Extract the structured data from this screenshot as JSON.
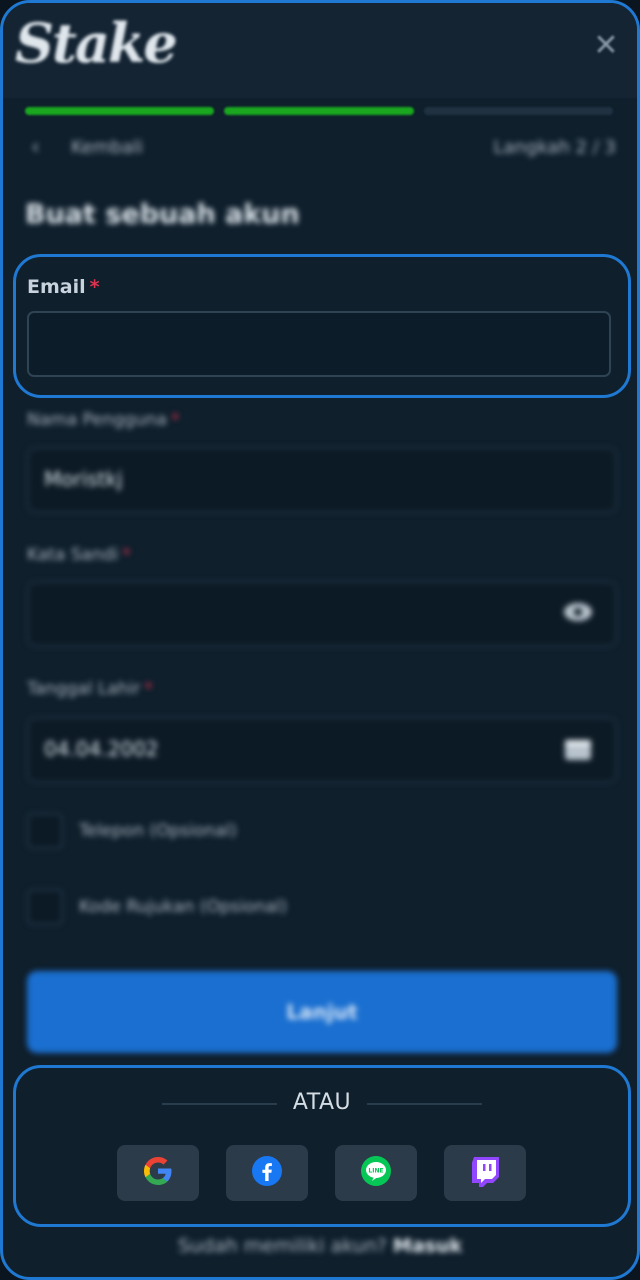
{
  "header": {
    "logo_text": "Stake",
    "close_icon": "close-icon"
  },
  "progress": {
    "total_steps": 3,
    "completed_steps": 2
  },
  "nav": {
    "back_label": "Kembali",
    "step_label": "Langkah 2 / 3"
  },
  "form": {
    "title": "Buat sebuah akun",
    "email": {
      "label": "Email",
      "required_mark": "*",
      "value": "",
      "placeholder": ""
    },
    "username": {
      "label": "Nama Pengguna",
      "required_mark": "*",
      "value": "Moristkj"
    },
    "password": {
      "label": "Kata Sandi",
      "required_mark": "*",
      "value": "",
      "icon": "eye-icon"
    },
    "birthdate": {
      "label": "Tanggal Lahir",
      "required_mark": "*",
      "value": "04.04.2002",
      "icon": "calendar-icon"
    },
    "phone_option": {
      "label": "Telepon (Opsional)"
    },
    "referral_option": {
      "label": "Kode Rujukan (Opsional)"
    },
    "continue_label": "Lanjut"
  },
  "social": {
    "or_label": "ATAU",
    "providers": [
      "google",
      "facebook",
      "line",
      "twitch"
    ]
  },
  "footer": {
    "prompt": "Sudah memiliki akun?",
    "login_label": "Masuk"
  },
  "colors": {
    "accent": "#1f78d1",
    "progress_done": "#1aa71f",
    "required": "#e0334f",
    "background": "#0f1f2c"
  }
}
